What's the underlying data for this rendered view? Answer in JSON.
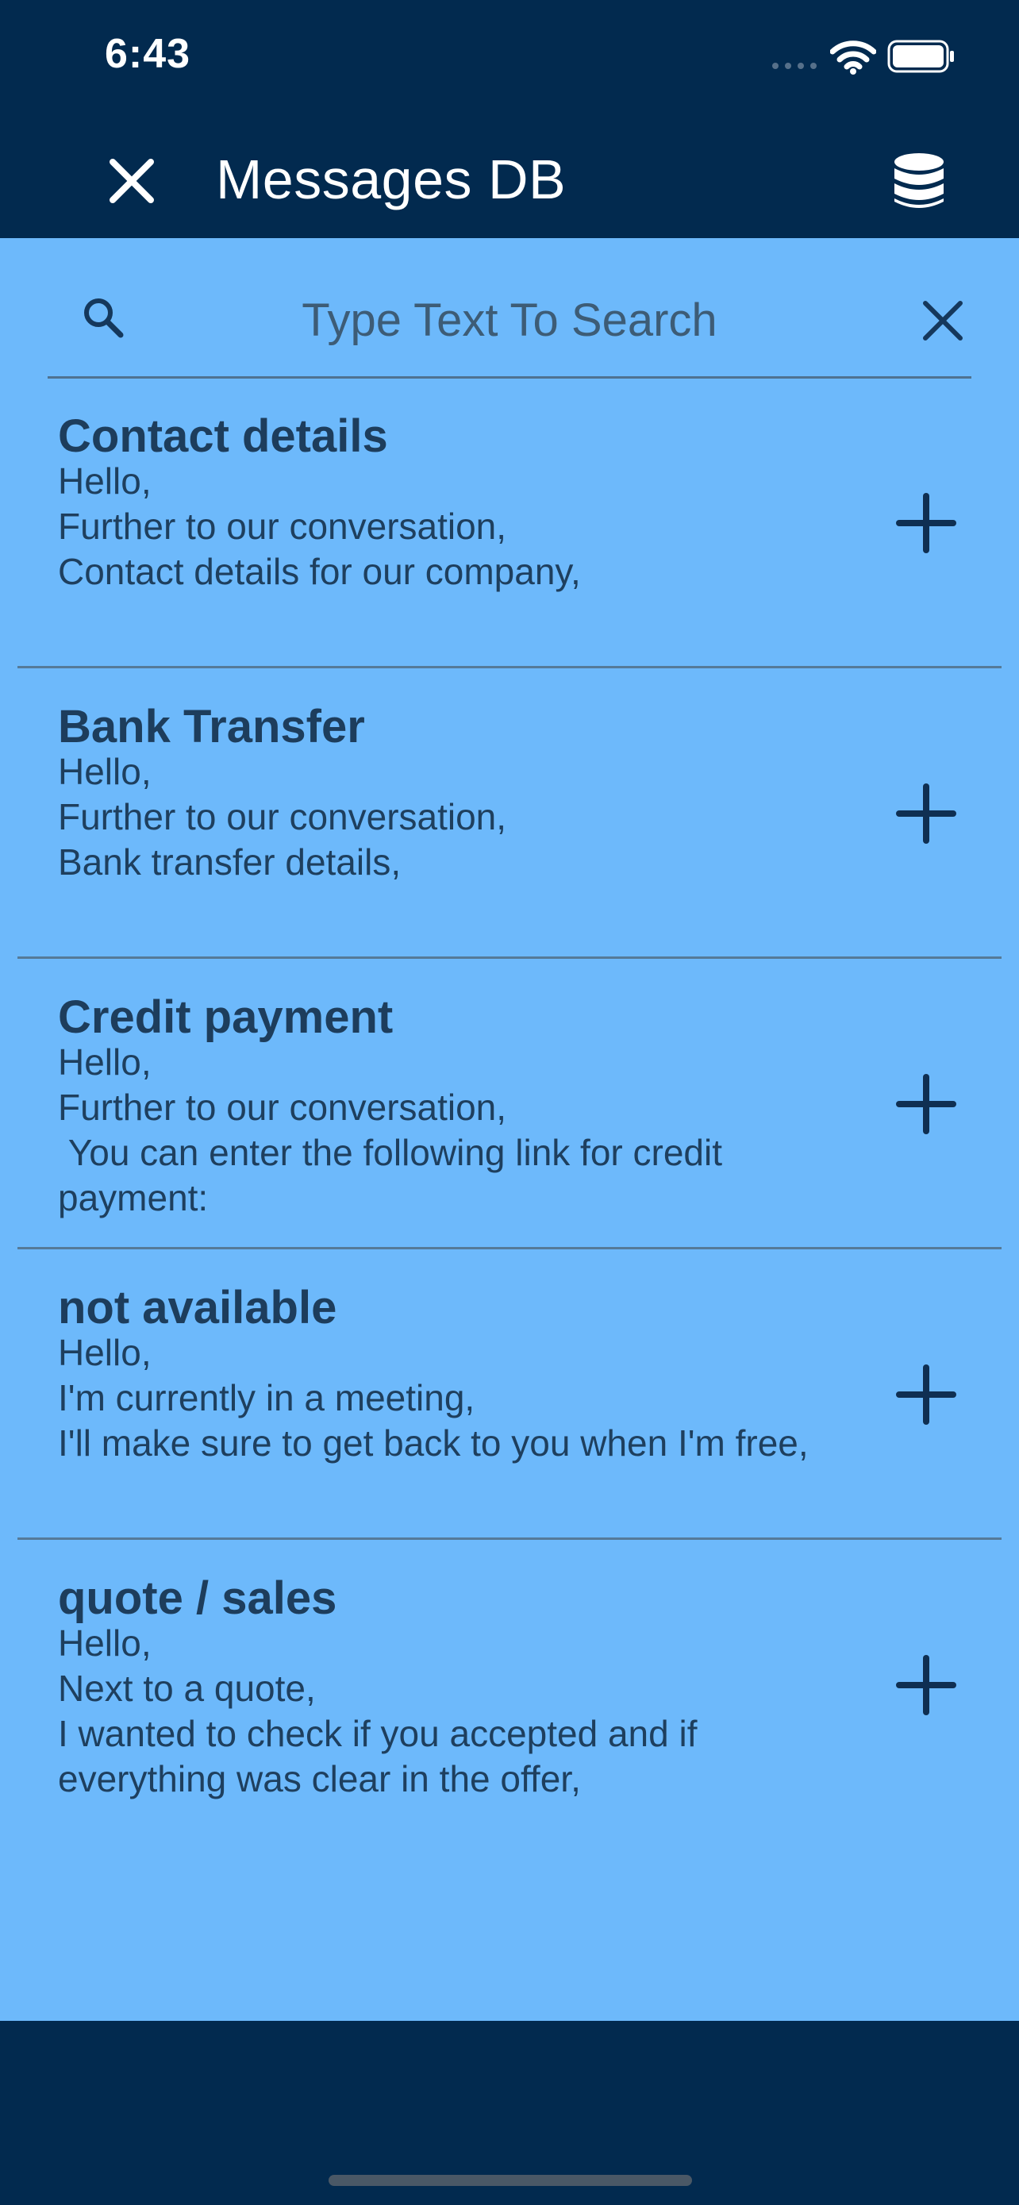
{
  "status_bar": {
    "time": "6:43"
  },
  "app_bar": {
    "title": "Messages DB",
    "close_icon": "close-icon",
    "db_icon": "database-icon"
  },
  "search": {
    "placeholder": "Type Text To Search",
    "value": ""
  },
  "messages": [
    {
      "title": "Contact details",
      "body": "Hello,\nFurther to our conversation,\nContact details for our company,"
    },
    {
      "title": "Bank Transfer",
      "body": "Hello,\nFurther to our conversation,\nBank transfer details,"
    },
    {
      "title": "Credit payment",
      "body": "Hello,\nFurther to our conversation,\n You can enter the following link for credit payment:"
    },
    {
      "title": "not available",
      "body": "Hello,\nI'm currently in a meeting,\nI'll make sure to get back to you when I'm free,"
    },
    {
      "title": "quote / sales",
      "body": "Hello,\nNext to a quote,\nI wanted to check if you accepted and if everything was clear in the offer,"
    }
  ],
  "colors": {
    "header": "#022a4f",
    "content": "#6db9fb",
    "text": "#1d3d5c"
  }
}
